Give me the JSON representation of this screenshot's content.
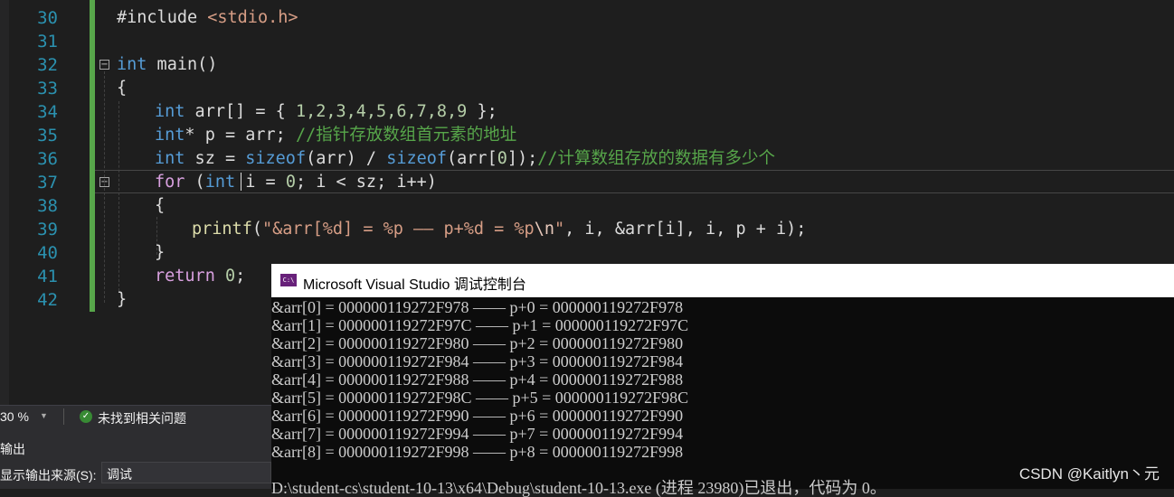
{
  "editor": {
    "line_numbers": [
      "30",
      "31",
      "32",
      "33",
      "34",
      "35",
      "36",
      "37",
      "38",
      "39",
      "40",
      "41",
      "42"
    ],
    "code": {
      "l30_a": "#include ",
      "l30_b": "<stdio.h>",
      "l32_kw": "int",
      "l32_rest": " main()",
      "l33": "{",
      "l34_kw": "int",
      "l34_a": " arr[] = { ",
      "l34_nums": "1,2,3,4,5,6,7,8,9",
      "l34_b": " };",
      "l35_kw": "int",
      "l35_a": "* p = arr; ",
      "l35_cmt": "//指针存放数组首元素的地址",
      "l36_kw": "int",
      "l36_a": " sz = ",
      "l36_sizeof1": "sizeof",
      "l36_b": "(arr) / ",
      "l36_sizeof2": "sizeof",
      "l36_c": "(arr[",
      "l36_zero": "0",
      "l36_d": "]);",
      "l36_cmt": "//计算数组存放的数据有多少个",
      "l37_for": "for",
      "l37_a": " (",
      "l37_kw": "int",
      "l37_b": " i = ",
      "l37_zero": "0",
      "l37_c": "; i < sz; i++)",
      "l38": "{",
      "l39_fn": "printf",
      "l39_a": "(",
      "l39_s1": "\"&arr[%d] = %p —— p+%d = %p",
      "l39_esc": "\\n",
      "l39_s2": "\"",
      "l39_b": ", i, &arr[i], i, p + i);",
      "l40": "}",
      "l41_kw": "return",
      "l41_sp": " ",
      "l41_zero": "0",
      "l41_semi": ";",
      "l42": "}"
    }
  },
  "status_bar": {
    "zoom": "30 %",
    "issues": "未找到相关问题"
  },
  "output_panel": {
    "title": "输出",
    "source_label": "显示输出来源(S):",
    "source_value": "调试"
  },
  "console": {
    "title": "Microsoft Visual Studio 调试控制台",
    "icon_text": "C:\\",
    "lines": [
      "&arr[0] = 000000119272F978 —— p+0 = 000000119272F978",
      "&arr[1] = 000000119272F97C —— p+1 = 000000119272F97C",
      "&arr[2] = 000000119272F980 —— p+2 = 000000119272F980",
      "&arr[3] = 000000119272F984 —— p+3 = 000000119272F984",
      "&arr[4] = 000000119272F988 —— p+4 = 000000119272F988",
      "&arr[5] = 000000119272F98C —— p+5 = 000000119272F98C",
      "&arr[6] = 000000119272F990 —— p+6 = 000000119272F990",
      "&arr[7] = 000000119272F994 —— p+7 = 000000119272F994",
      "&arr[8] = 000000119272F998 —— p+8 = 000000119272F998"
    ],
    "exit_line": "D:\\student-cs\\student-10-13\\x64\\Debug\\student-10-13.exe (进程 23980)已退出，代码为 0。"
  },
  "watermark": "CSDN @Kaitlyn丶元",
  "colors": {
    "keyword": "#569cd6",
    "comment": "#57a64a",
    "string": "#d69d85",
    "line_number": "#2b91af",
    "change_bar": "#57a64a"
  }
}
